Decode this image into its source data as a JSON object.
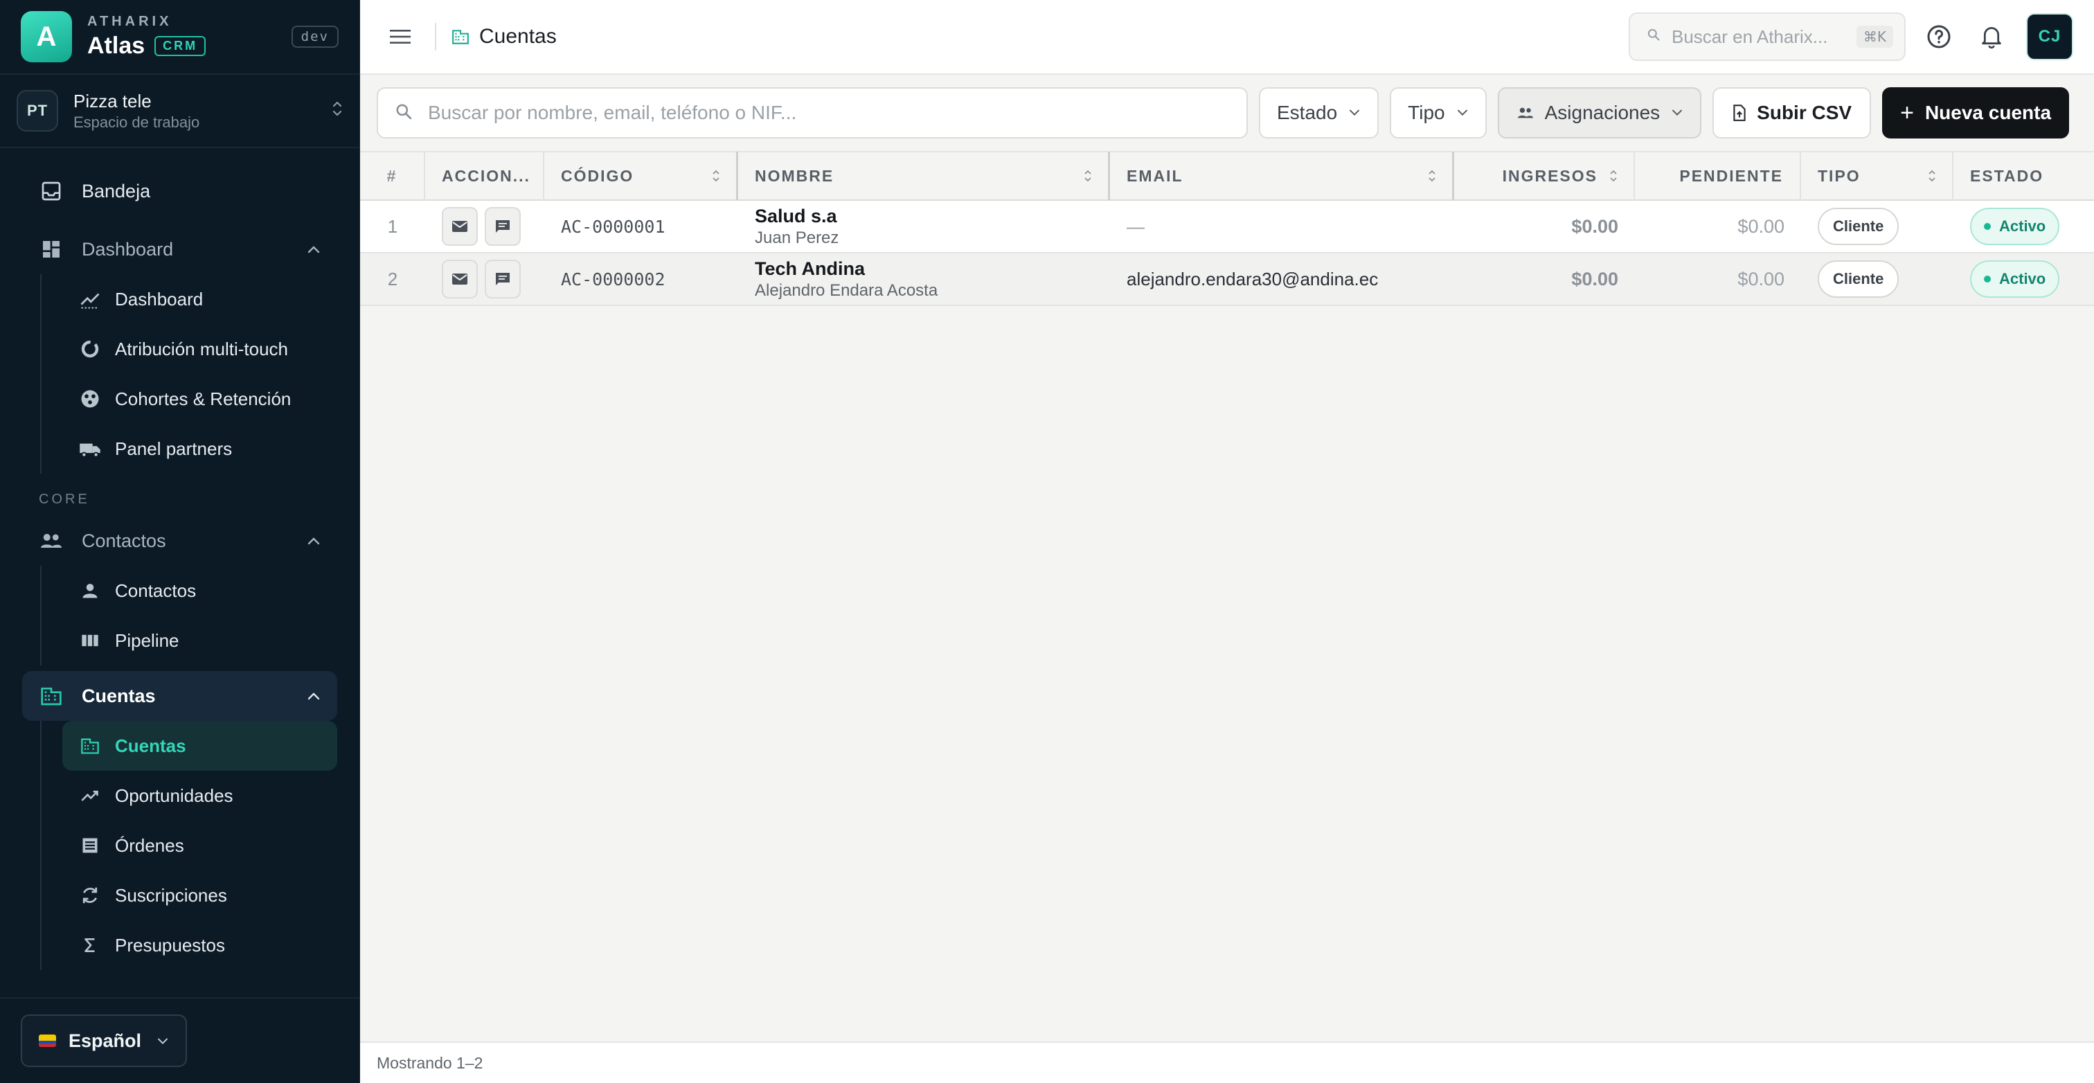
{
  "brand": {
    "eyebrow": "ATHARIX",
    "logo_letter": "A",
    "name": "Atlas",
    "crm_badge": "CRM",
    "env_badge": "dev"
  },
  "workspace": {
    "initials": "PT",
    "name": "Pizza tele",
    "subtitle": "Espacio de trabajo"
  },
  "sidebar": {
    "inbox": {
      "label": "Bandeja",
      "icon": "inbox-icon"
    },
    "dashboard_group": {
      "label": "Dashboard",
      "icon": "dashboard-icon",
      "expanded": true,
      "items": [
        {
          "label": "Dashboard",
          "icon": "trend-icon"
        },
        {
          "label": "Atribución multi-touch",
          "icon": "donut-icon"
        },
        {
          "label": "Cohortes & Retención",
          "icon": "cohorts-icon"
        },
        {
          "label": "Panel partners",
          "icon": "truck-icon"
        }
      ]
    },
    "section_core": "CORE",
    "contacts_group": {
      "label": "Contactos",
      "icon": "people-icon",
      "expanded": true,
      "items": [
        {
          "label": "Contactos",
          "icon": "person-icon"
        },
        {
          "label": "Pipeline",
          "icon": "columns-icon"
        }
      ]
    },
    "accounts_group": {
      "label": "Cuentas",
      "icon": "building-icon",
      "expanded": true,
      "items": [
        {
          "label": "Cuentas",
          "icon": "building-icon",
          "active": true
        },
        {
          "label": "Oportunidades",
          "icon": "trend-icon"
        },
        {
          "label": "Órdenes",
          "icon": "list-icon"
        },
        {
          "label": "Suscripciones",
          "icon": "refresh-icon"
        },
        {
          "label": "Presupuestos",
          "icon": "sigma-icon"
        }
      ]
    },
    "language": {
      "label": "Español",
      "flag": "ecuador-flag-icon"
    }
  },
  "topbar": {
    "title": "Cuentas",
    "search_placeholder": "Buscar en Atharix...",
    "shortcut": "⌘K",
    "user_initials": "CJ"
  },
  "toolbar": {
    "search_placeholder": "Buscar por nombre, email, teléfono o NIF...",
    "filter_estado": "Estado",
    "filter_tipo": "Tipo",
    "filter_asignaciones": "Asignaciones",
    "upload_csv": "Subir CSV",
    "new_account": "Nueva cuenta"
  },
  "table": {
    "headers": {
      "num": "#",
      "actions": "ACCION...",
      "code": "CÓDIGO",
      "name": "NOMBRE",
      "email": "EMAIL",
      "revenue": "INGRESOS",
      "pending": "PENDIENTE",
      "type": "TIPO",
      "status": "ESTADO"
    },
    "rows": [
      {
        "num": "1",
        "code": "AC-0000001",
        "name": "Salud s.a",
        "contact": "Juan Perez",
        "email": "—",
        "revenue": "$0.00",
        "pending": "$0.00",
        "type": "Cliente",
        "status": "Activo"
      },
      {
        "num": "2",
        "code": "AC-0000002",
        "name": "Tech Andina",
        "contact": "Alejandro Endara Acosta",
        "email": "alejandro.endara30@andina.ec",
        "revenue": "$0.00",
        "pending": "$0.00",
        "type": "Cliente",
        "status": "Activo"
      }
    ]
  },
  "footer": {
    "showing": "Mostrando 1–2"
  },
  "colors": {
    "accent": "#1fc2a4",
    "sidebar_bg": "#0c1a26",
    "primary_button": "#121518",
    "status_active": "#19b894"
  }
}
